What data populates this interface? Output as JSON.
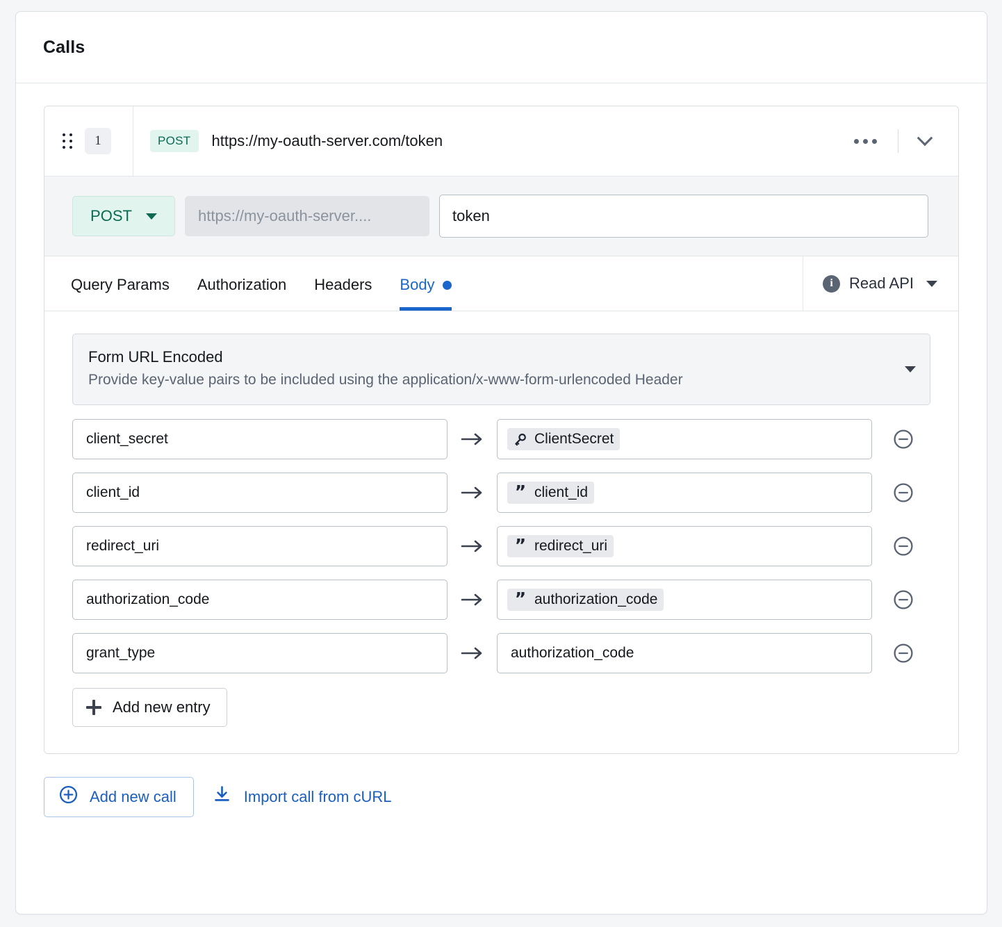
{
  "header": {
    "title": "Calls"
  },
  "call": {
    "index": "1",
    "method_badge": "POST",
    "url_display": "https://my-oauth-server.com/token",
    "more_icon": "ellipsis-icon",
    "collapse_icon": "chevron-down-icon",
    "drag_icon": "drag-handle-icon"
  },
  "url_editor": {
    "method": "POST",
    "base_url_placeholder": "https://my-oauth-server....",
    "path_value": "token"
  },
  "tabs": [
    {
      "label": "Query Params",
      "active": false,
      "dot": false
    },
    {
      "label": "Authorization",
      "active": false,
      "dot": false
    },
    {
      "label": "Headers",
      "active": false,
      "dot": false
    },
    {
      "label": "Body",
      "active": true,
      "dot": true
    }
  ],
  "read_api": {
    "label": "Read API",
    "info_glyph": "i",
    "info_icon": "info-icon",
    "caret_icon": "chevron-down-icon"
  },
  "body_type": {
    "title": "Form URL Encoded",
    "subtitle": "Provide key-value pairs to be included using the application/x-www-form-urlencoded Header",
    "caret_icon": "chevron-down-icon"
  },
  "entries": [
    {
      "key": "client_secret",
      "value": "ClientSecret",
      "value_kind": "secret",
      "icon": "key-icon"
    },
    {
      "key": "client_id",
      "value": "client_id",
      "value_kind": "variable",
      "icon": "quote-icon"
    },
    {
      "key": "redirect_uri",
      "value": "redirect_uri",
      "value_kind": "variable",
      "icon": "quote-icon"
    },
    {
      "key": "authorization_code",
      "value": "authorization_code",
      "value_kind": "variable",
      "icon": "quote-icon"
    },
    {
      "key": "grant_type",
      "value": "authorization_code",
      "value_kind": "plain",
      "icon": ""
    }
  ],
  "entry_arrow_icon": "arrow-right-icon",
  "entry_remove_icon": "minus-circle-icon",
  "add_entry": {
    "label": "Add new entry",
    "icon": "plus-icon"
  },
  "footer": {
    "add_call": {
      "label": "Add new call",
      "icon": "plus-circle-icon"
    },
    "import_curl": {
      "label": "Import call from cURL",
      "icon": "download-icon"
    }
  },
  "colors": {
    "accent_blue": "#1a66cc",
    "link_blue": "#1a5fc0",
    "method_green": "#0c6a52",
    "method_green_bg": "#e1f4ed",
    "muted": "#5b6472",
    "panel_bg": "#f3f5f7",
    "page_bg": "#f4f6f8"
  }
}
